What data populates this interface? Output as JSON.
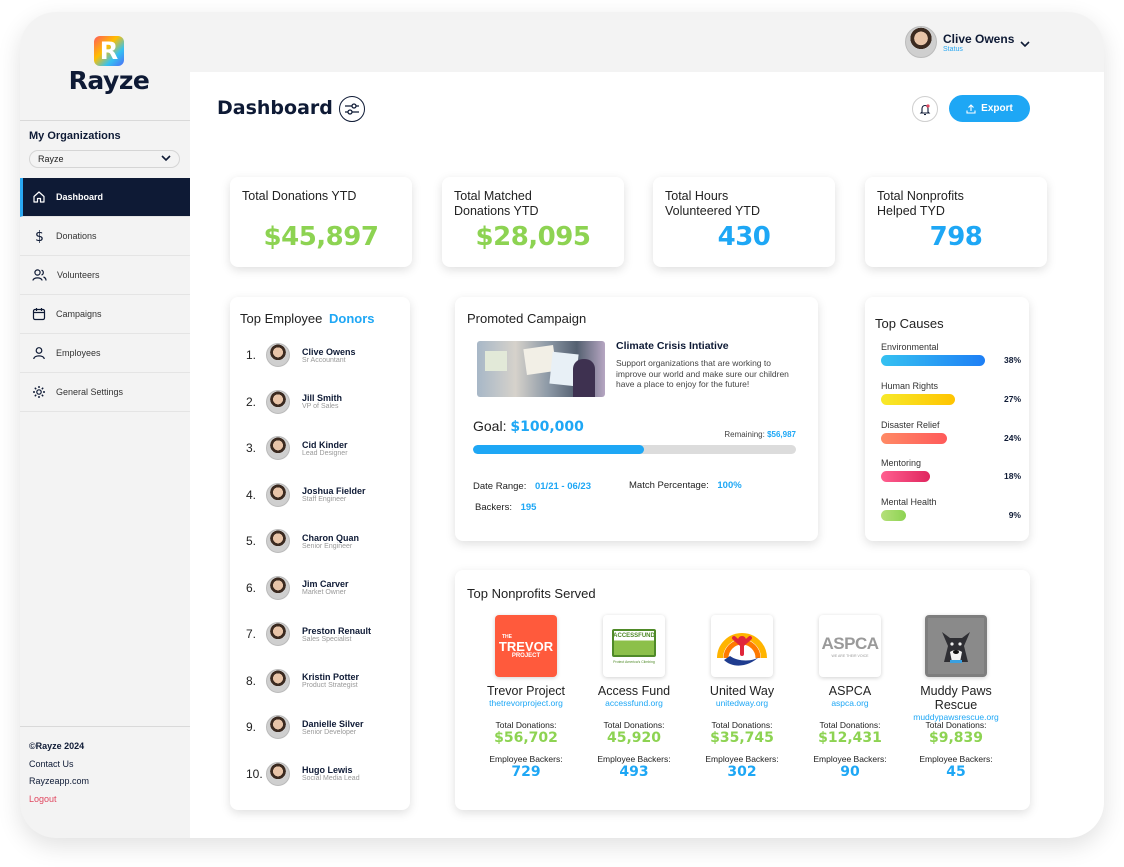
{
  "brand": {
    "name": "Rayze",
    "mark": "R"
  },
  "sidebar": {
    "org_title": "My Organizations",
    "org_selected": "Rayze",
    "items": [
      {
        "label": "Dashboard",
        "icon": "home-icon",
        "active": true
      },
      {
        "label": "Donations",
        "icon": "dollar-icon"
      },
      {
        "label": "Volunteers",
        "icon": "users-icon"
      },
      {
        "label": "Campaigns",
        "icon": "calendar-icon"
      },
      {
        "label": "Employees",
        "icon": "user-icon"
      },
      {
        "label": "General Settings",
        "icon": "gear-icon"
      }
    ],
    "footer": {
      "copyright": "©Rayze 2024",
      "contact": "Contact Us",
      "site": "Rayzeapp.com",
      "logout": "Logout"
    }
  },
  "header": {
    "user_name": "Clive Owens",
    "user_status": "Status",
    "page_title": "Dashboard",
    "export_label": "Export"
  },
  "stats": [
    {
      "label": "Total Donations YTD",
      "value": "$45,897",
      "color": "#8dd352"
    },
    {
      "label": "Total Matched Donations YTD",
      "value": "$28,095",
      "color": "#8dd352"
    },
    {
      "label": "Total Hours Volunteered YTD",
      "value": "430",
      "color": "#1ea7f5"
    },
    {
      "label": "Total Nonprofits Helped TYD",
      "value": "798",
      "color": "#1ea7f5"
    }
  ],
  "donors": {
    "title_prefix": "Top Employee",
    "title_accent": "Donors",
    "list": [
      {
        "rank": "1.",
        "name": "Clive Owens",
        "role": "Sr Accountant"
      },
      {
        "rank": "2.",
        "name": "Jill Smith",
        "role": "VP of Sales"
      },
      {
        "rank": "3.",
        "name": "Cid Kinder",
        "role": "Lead Designer"
      },
      {
        "rank": "4.",
        "name": "Joshua Fielder",
        "role": "Staff Engineer"
      },
      {
        "rank": "5.",
        "name": "Charon Quan",
        "role": "Senior Engineer"
      },
      {
        "rank": "6.",
        "name": "Jim Carver",
        "role": "Market Owner"
      },
      {
        "rank": "7.",
        "name": "Preston Renault",
        "role": "Sales Specialist"
      },
      {
        "rank": "8.",
        "name": "Kristin Potter",
        "role": "Product Strategist"
      },
      {
        "rank": "9.",
        "name": "Danielle Silver",
        "role": "Senior Developer"
      },
      {
        "rank": "10.",
        "name": "Hugo Lewis",
        "role": "Social Media Lead"
      }
    ]
  },
  "campaign": {
    "title": "Promoted Campaign",
    "name": "Climate Crisis Intiative",
    "description": "Support organizations that are working to improve our world and make sure our children have a place to enjoy for the future!",
    "goal_label": "Goal:",
    "goal_value": "$100,000",
    "remaining_label": "Remaining:",
    "remaining_value": "$56,987",
    "progress": 0.53,
    "date_label": "Date Range:",
    "date_value": "01/21 - 06/23",
    "match_label": "Match Percentage:",
    "match_value": "100%",
    "backers_label": "Backers:",
    "backers_value": "195"
  },
  "causes": {
    "title": "Top Causes",
    "list": [
      {
        "label": "Environmental",
        "pct": "38%",
        "value": 38,
        "color_a": "#35c1f1",
        "color_b": "#1e7ff5"
      },
      {
        "label": "Human Rights",
        "pct": "27%",
        "value": 27,
        "color_a": "#f7e92a",
        "color_b": "#ffc400"
      },
      {
        "label": "Disaster Relief",
        "pct": "24%",
        "value": 24,
        "color_a": "#ff8a65",
        "color_b": "#ff5a5a"
      },
      {
        "label": "Mentoring",
        "pct": "18%",
        "value": 18,
        "color_a": "#ff5f8f",
        "color_b": "#e0265f"
      },
      {
        "label": "Mental Health",
        "pct": "9%",
        "value": 9,
        "color_a": "#b5e07a",
        "color_b": "#8dd352"
      }
    ]
  },
  "nonprofits": {
    "title": "Top Nonprofits Served",
    "donations_label": "Total Donations:",
    "backers_label": "Employee Backers:",
    "list": [
      {
        "name": "Trevor Project",
        "url": "thetrevorproject.org",
        "donations": "$56,702",
        "backers": "729",
        "logo_text": "TREVOR",
        "logo_sub": "PROJECT",
        "logo_small": "THE"
      },
      {
        "name": "Access Fund",
        "url": "accessfund.org",
        "donations": "45,920",
        "backers": "493",
        "logo_text": "ACCESSFUND",
        "logo_sub": "Protect America's Climbing"
      },
      {
        "name": "United Way",
        "url": "unitedway.org",
        "donations": "$35,745",
        "backers": "302"
      },
      {
        "name": "ASPCA",
        "url": "aspca.org",
        "donations": "$12,431",
        "backers": "90",
        "logo_text": "ASPCA",
        "logo_sub": "WE ARE THEIR VOICE"
      },
      {
        "name": "Muddy Paws Rescue",
        "url": "muddypawsrescue.org",
        "donations": "$9,839",
        "backers": "45"
      }
    ]
  }
}
